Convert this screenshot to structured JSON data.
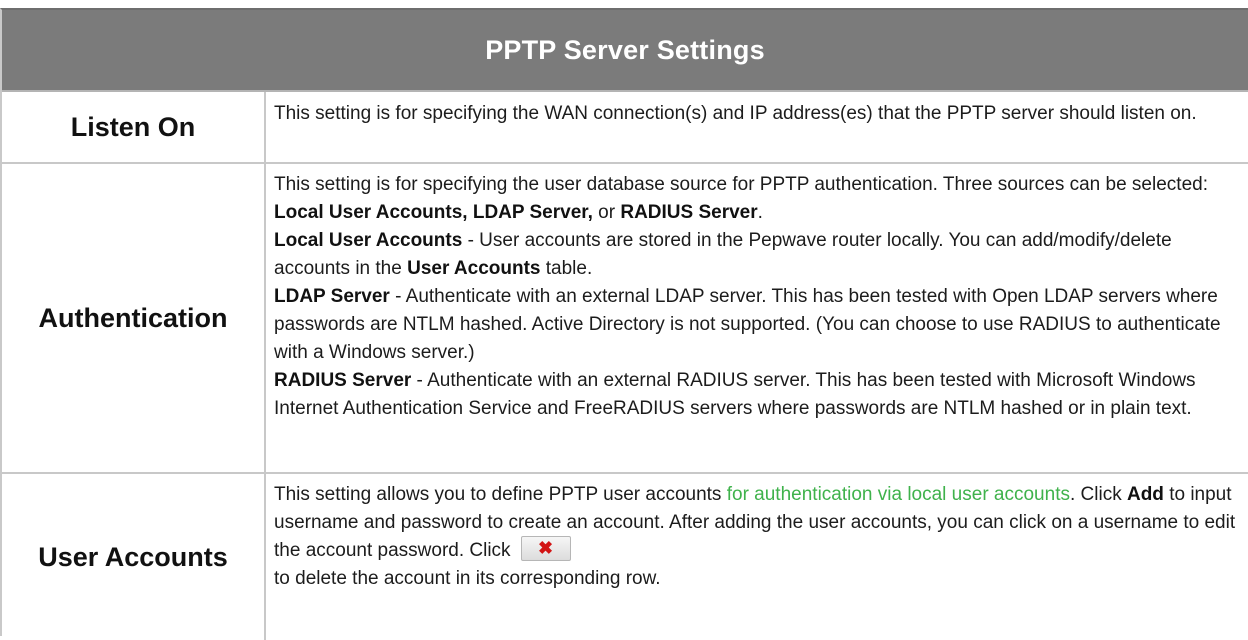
{
  "title": "PPTP Server Settings",
  "rows": [
    {
      "label": "Listen On",
      "text": "This setting is for specifying the WAN connection(s) and IP address(es) that the PPTP server should listen on."
    },
    {
      "label": "Authentication",
      "intro": "This setting is for specifying the user database source for PPTP authentication. Three sources can be selected: ",
      "opt1": "Local User Accounts, LDAP Server,",
      "or": " or ",
      "opt2": "RADIUS Server",
      "period": ".",
      "local_term": "Local User Accounts",
      "local_text": " - User accounts are stored in the Pepwave router locally. You can add/modify/delete accounts in the ",
      "local_table": "User Accounts",
      "local_end": " table.",
      "ldap_term": "LDAP Server",
      "ldap_text": " - Authenticate with an external LDAP server. This has been tested with Open LDAP servers where passwords are NTLM hashed. Active Directory is not supported. (You can choose to use RADIUS to authenticate with a Windows server.)",
      "radius_term": "RADIUS Server",
      "radius_text": " - Authenticate with an external RADIUS server. This has been tested with Microsoft Windows Internet Authentication Service and FreeRADIUS servers where passwords are NTLM hashed or in plain text."
    },
    {
      "label": "User Accounts",
      "intro": "This setting allows you to define PPTP user accounts ",
      "link": "for authentication via local user accounts",
      "p2": ". Click ",
      "add": "Add",
      "p3": " to input username and password to create an account. After adding the user accounts, you can click on a username to edit the account password. Click",
      "p4": "to delete the account in its corresponding row.",
      "delete_icon": "✖"
    }
  ],
  "colors": {
    "header_bg": "#7b7b7b",
    "link": "#3fb24b",
    "delete_icon": "#d21414"
  }
}
